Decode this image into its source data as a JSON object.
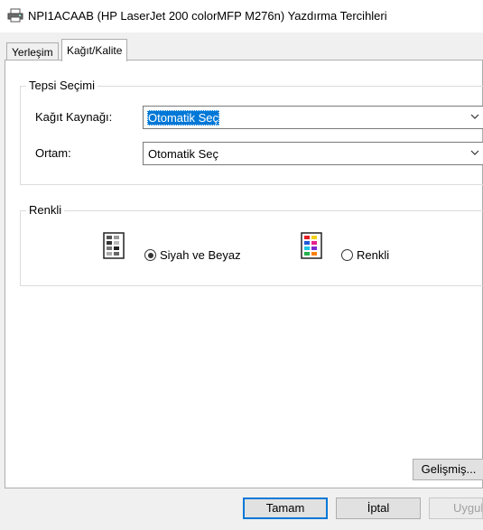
{
  "window": {
    "title": "NPI1ACAAB (HP LaserJet 200 colorMFP M276n) Yazdırma Tercihleri",
    "icon": "printer-icon"
  },
  "tabs": [
    {
      "label": "Yerleşim",
      "active": false
    },
    {
      "label": "Kağıt/Kalite",
      "active": true
    }
  ],
  "tray_group": {
    "label": "Tepsi Seçimi",
    "paper_source_label": "Kağıt Kaynağı:",
    "paper_source_value": "Otomatik Seç",
    "media_label": "Ortam:",
    "media_value": "Otomatik Seç"
  },
  "color_group": {
    "label": "Renkli",
    "bw_label": "Siyah ve Beyaz",
    "bw_selected": true,
    "color_label": "Renkli",
    "color_selected": false,
    "bw_icon": "grayscale-palette-icon",
    "color_icon": "color-palette-icon"
  },
  "advanced_button": "Gelişmiş...",
  "footer": {
    "ok": "Tamam",
    "cancel": "İptal",
    "apply": "Uygula"
  },
  "colors": {
    "selection": "#0078d7",
    "panel": "#ffffff",
    "chrome": "#f0f0f0"
  }
}
